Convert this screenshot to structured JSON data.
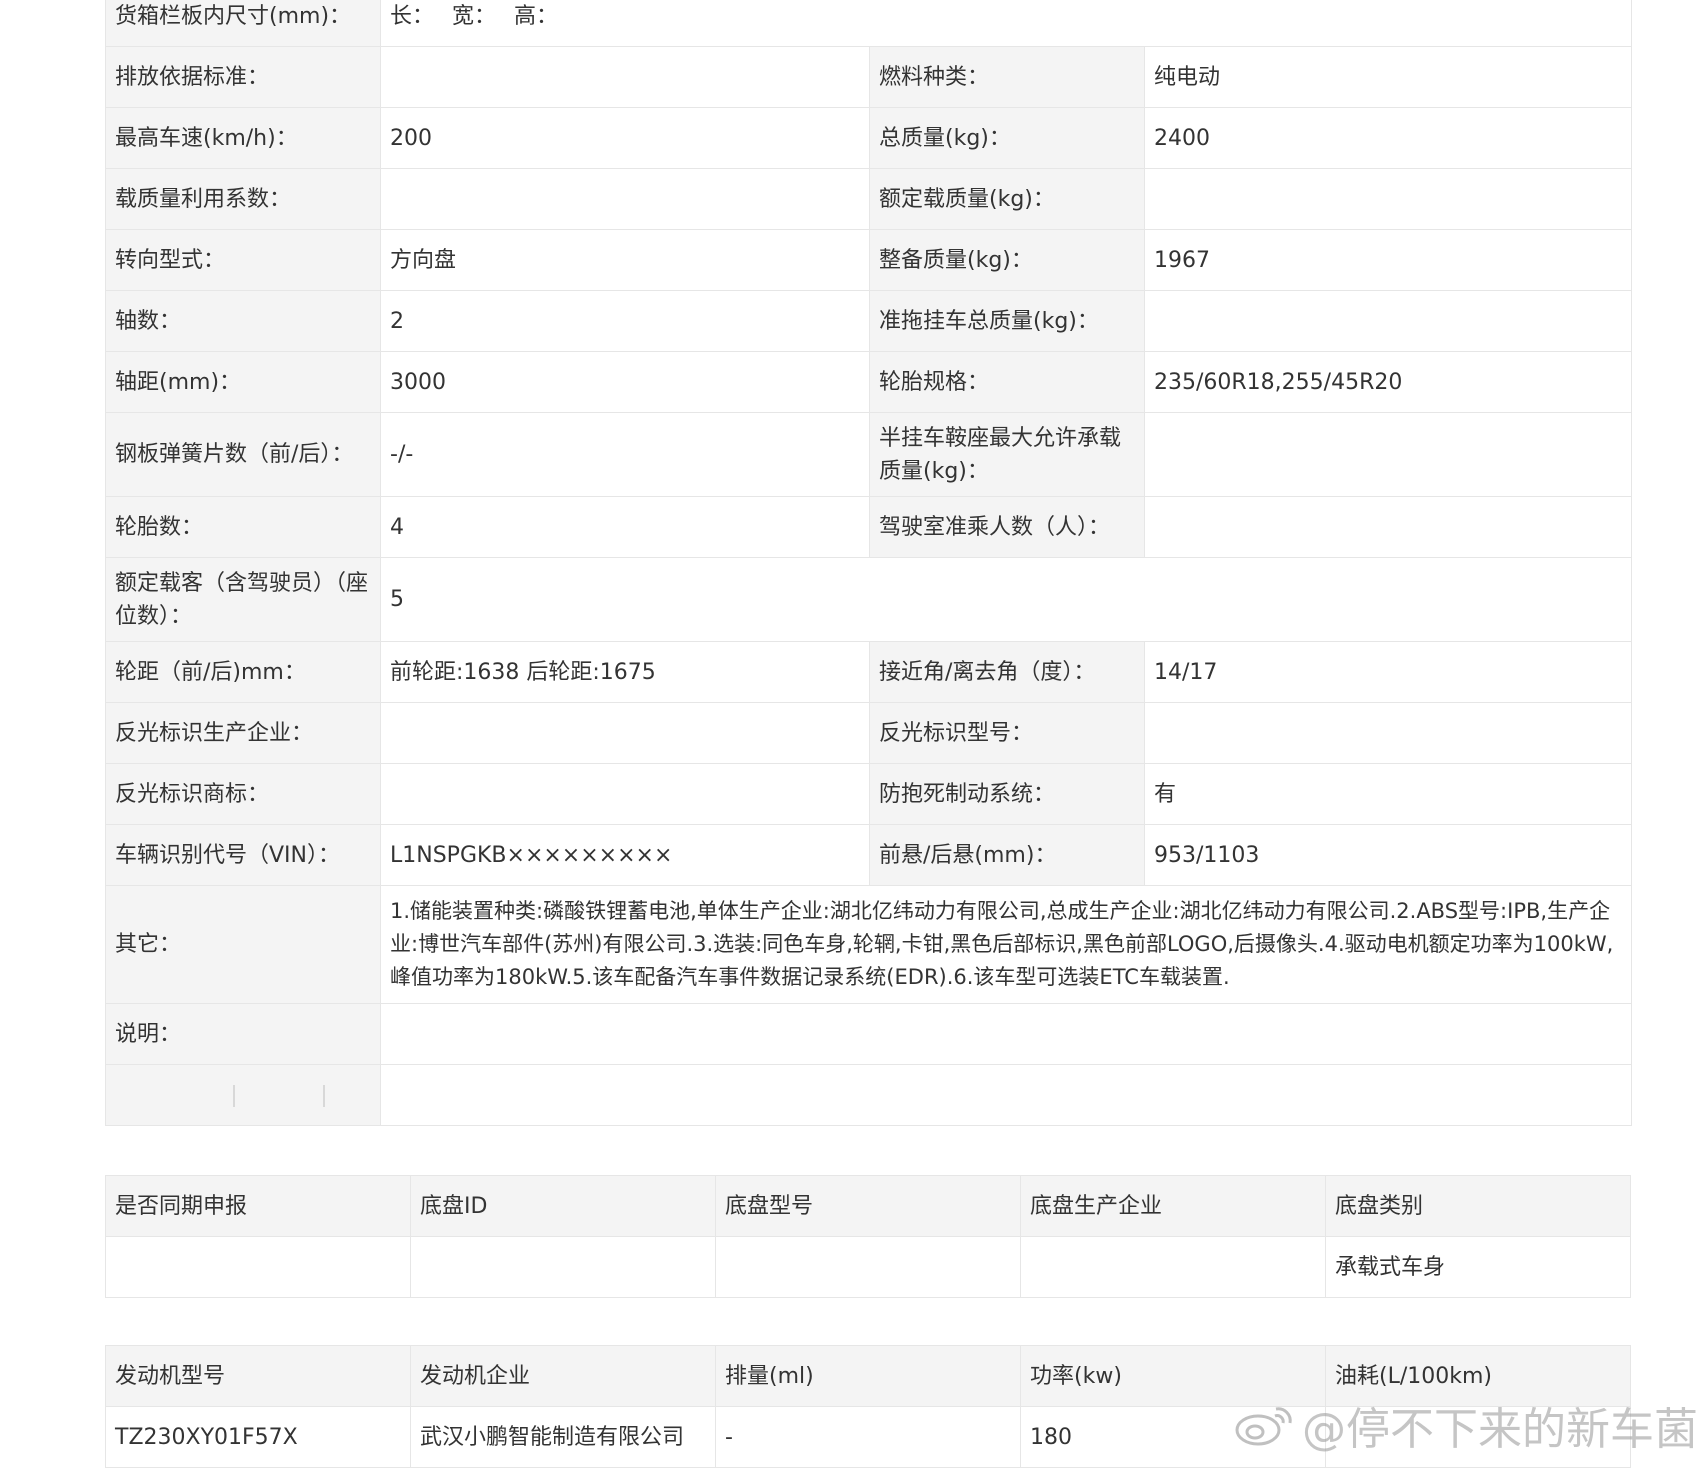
{
  "spec": {
    "cargo_dim_label": "货箱栏板内尺寸(mm)：",
    "cargo_dim_length": "长：",
    "cargo_dim_width": "宽：",
    "cargo_dim_height": "高：",
    "emission_std_label": "排放依据标准：",
    "emission_std_value": "",
    "fuel_type_label": "燃料种类：",
    "fuel_type_value": "纯电动",
    "max_speed_label": "最高车速(km/h)：",
    "max_speed_value": "200",
    "total_mass_label": "总质量(kg)：",
    "total_mass_value": "2400",
    "load_util_label": "载质量利用系数：",
    "load_util_value": "",
    "rated_load_label": "额定载质量(kg)：",
    "rated_load_value": "",
    "steering_label": "转向型式：",
    "steering_value": "方向盘",
    "curb_mass_label": "整备质量(kg)：",
    "curb_mass_value": "1967",
    "axles_label": "轴数：",
    "axles_value": "2",
    "trailer_mass_label": "准拖挂车总质量(kg)：",
    "trailer_mass_value": "",
    "wheelbase_label": "轴距(mm)：",
    "wheelbase_value": "3000",
    "tire_spec_label": "轮胎规格：",
    "tire_spec_value": "235/60R18,255/45R20",
    "leaf_spring_label": "钢板弹簧片数（前/后）：",
    "leaf_spring_value": "-/-",
    "saddle_load_label": "半挂车鞍座最大允许承载质量(kg)：",
    "saddle_load_value": "",
    "tire_count_label": "轮胎数：",
    "tire_count_value": "4",
    "cab_passengers_label": "驾驶室准乘人数（人）：",
    "cab_passengers_value": "",
    "rated_passengers_label": "额定载客（含驾驶员）（座位数）：",
    "rated_passengers_value": "5",
    "track_label": "轮距（前/后)mm：",
    "track_value": "前轮距:1638 后轮距:1675",
    "angles_label": "接近角/离去角（度）：",
    "angles_value": "14/17",
    "reflector_maker_label": "反光标识生产企业：",
    "reflector_maker_value": "",
    "reflector_model_label": "反光标识型号：",
    "reflector_model_value": "",
    "reflector_brand_label": "反光标识商标：",
    "reflector_brand_value": "",
    "abs_label": "防抱死制动系统：",
    "abs_value": "有",
    "vin_label": "车辆识别代号（VIN）：",
    "vin_value": "L1NSPGKB×××××××××",
    "overhang_label": "前悬/后悬(mm)：",
    "overhang_value": "953/1103",
    "other_label": "其它：",
    "other_value": "1.储能装置种类:磷酸铁锂蓄电池,单体生产企业:湖北亿纬动力有限公司,总成生产企业:湖北亿纬动力有限公司.2.ABS型号:IPB,生产企业:博世汽车部件(苏州)有限公司.3.选装:同色车身,轮辋,卡钳,黑色后部标识,黑色前部LOGO,后摄像头.4.驱动电机额定功率为100kW,峰值功率为180kW.5.该车配备汽车事件数据记录系统(EDR).6.该车型可选装ETC车载装置.",
    "note_label": "说明：",
    "note_value": ""
  },
  "chassis": {
    "headers": [
      "是否同期申报",
      "底盘ID",
      "底盘型号",
      "底盘生产企业",
      "底盘类别"
    ],
    "row": [
      "",
      "",
      "",
      "",
      "承载式车身"
    ]
  },
  "engine": {
    "headers": [
      "发动机型号",
      "发动机企业",
      "排量(ml)",
      "功率(kw)",
      "油耗(L/100km)"
    ],
    "row": [
      "TZ230XY01F57X",
      "武汉小鹏智能制造有限公司",
      "-",
      "180",
      ""
    ]
  },
  "watermark": {
    "text": "@停不下来的新车菌",
    "icon": "weibo-icon"
  }
}
